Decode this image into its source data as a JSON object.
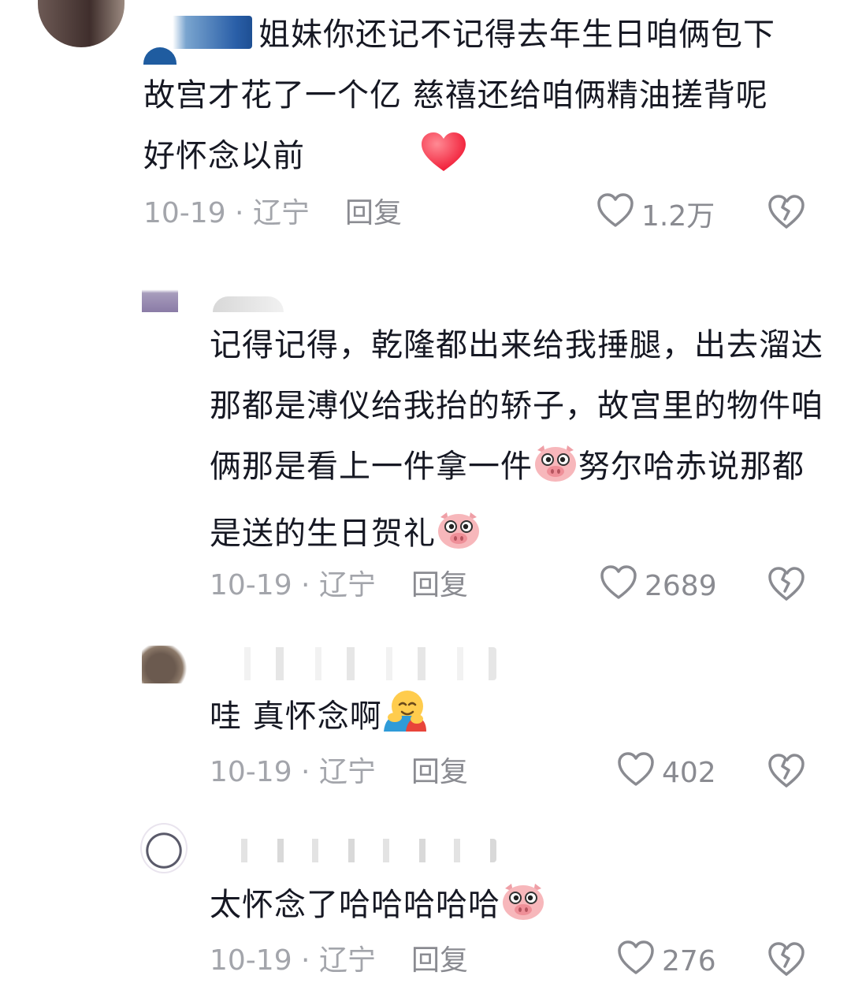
{
  "comments": [
    {
      "text": "姐妹你还记不记得去年生日咱俩包下故宫才花了一个亿 慈禧还给咱俩精油搓背呢 好怀念以前",
      "emoji": "heart-emoji",
      "date": "10-19",
      "location": "辽宁",
      "reply_label": "回复",
      "likes": "1.2万"
    },
    {
      "text": "记得记得，乾隆都出来给我捶腿，出去溜达那都是溥仪给我抬的轿子，故宫里的物件咱俩那是看上一件拿一件",
      "text_2": "努尔哈赤说那都是送的生日贺礼",
      "emoji": "pig-face-emoji",
      "date": "10-19",
      "location": "辽宁",
      "reply_label": "回复",
      "likes": "2689"
    },
    {
      "text": "哇 真怀念啊",
      "emoji": "hugging-face-emoji",
      "date": "10-19",
      "location": "辽宁",
      "reply_label": "回复",
      "likes": "402"
    },
    {
      "text": "太怀念了哈哈哈哈哈",
      "emoji": "pig-face-emoji",
      "date": "10-19",
      "location": "辽宁",
      "reply_label": "回复",
      "likes": "276"
    }
  ],
  "separator": " · ",
  "colors": {
    "text": "#161823",
    "meta": "#a3a5ab",
    "icon": "#8a8b91",
    "pig": "#f6b3b3",
    "heart": "#ff3b4f"
  }
}
